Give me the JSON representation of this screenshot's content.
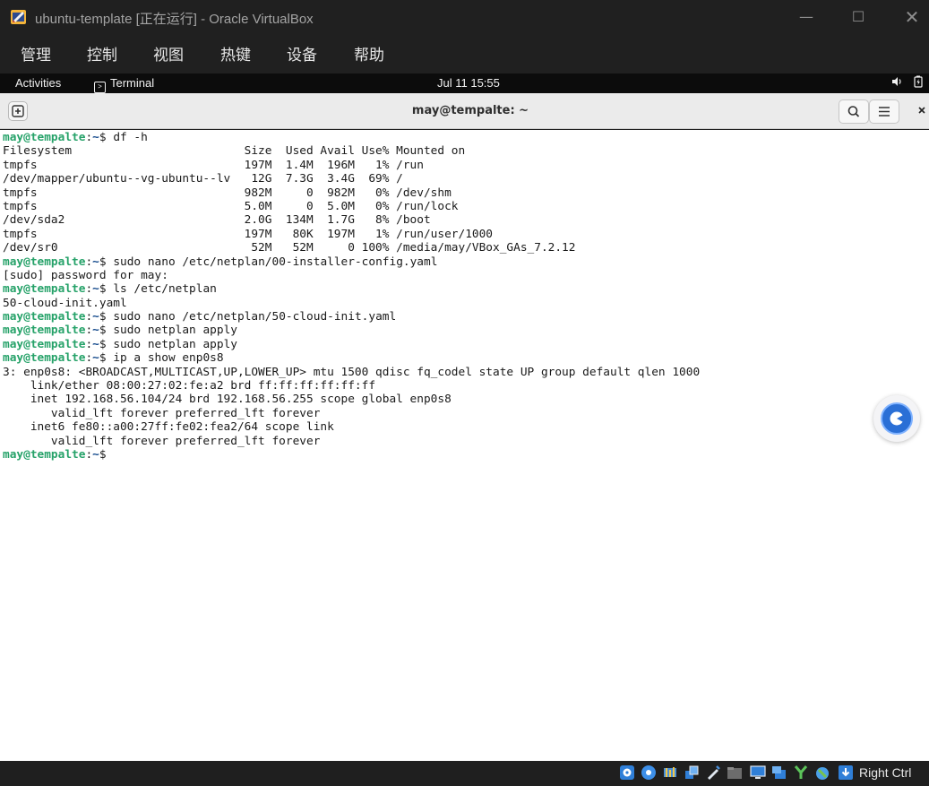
{
  "window": {
    "title": "ubuntu-template [正在运行] - Oracle VirtualBox",
    "minimize_glyph": "—",
    "maximize_glyph": "☐",
    "close_glyph": "✕"
  },
  "menu": [
    "管理",
    "控制",
    "视图",
    "热键",
    "设备",
    "帮助"
  ],
  "gnome": {
    "activities": "Activities",
    "app_label": "Terminal",
    "clock": "Jul 11  15:55"
  },
  "terminal": {
    "title": "may@tempalte: ~",
    "lines": [
      {
        "user": "may@tempalte",
        "path": "~",
        "cmd": " df -h"
      },
      {
        "text": "Filesystem                         Size  Used Avail Use% Mounted on"
      },
      {
        "text": "tmpfs                              197M  1.4M  196M   1% /run"
      },
      {
        "text": "/dev/mapper/ubuntu--vg-ubuntu--lv   12G  7.3G  3.4G  69% /"
      },
      {
        "text": "tmpfs                              982M     0  982M   0% /dev/shm"
      },
      {
        "text": "tmpfs                              5.0M     0  5.0M   0% /run/lock"
      },
      {
        "text": "/dev/sda2                          2.0G  134M  1.7G   8% /boot"
      },
      {
        "text": "tmpfs                              197M   80K  197M   1% /run/user/1000"
      },
      {
        "text": "/dev/sr0                            52M   52M     0 100% /media/may/VBox_GAs_7.2.12"
      },
      {
        "user": "may@tempalte",
        "path": "~",
        "cmd": " sudo nano /etc/netplan/00-installer-config.yaml"
      },
      {
        "text": "[sudo] password for may:"
      },
      {
        "user": "may@tempalte",
        "path": "~",
        "cmd": " ls /etc/netplan"
      },
      {
        "text": "50-cloud-init.yaml"
      },
      {
        "user": "may@tempalte",
        "path": "~",
        "cmd": " sudo nano /etc/netplan/50-cloud-init.yaml"
      },
      {
        "user": "may@tempalte",
        "path": "~",
        "cmd": " sudo netplan apply"
      },
      {
        "user": "may@tempalte",
        "path": "~",
        "cmd": " sudo netplan apply"
      },
      {
        "user": "may@tempalte",
        "path": "~",
        "cmd": " ip a show enp0s8"
      },
      {
        "text": "3: enp0s8: <BROADCAST,MULTICAST,UP,LOWER_UP> mtu 1500 qdisc fq_codel state UP group default qlen 1000"
      },
      {
        "text": "    link/ether 08:00:27:02:fe:a2 brd ff:ff:ff:ff:ff:ff"
      },
      {
        "text": "    inet 192.168.56.104/24 brd 192.168.56.255 scope global enp0s8"
      },
      {
        "text": "       valid_lft forever preferred_lft forever"
      },
      {
        "text": "    inet6 fe80::a00:27ff:fe02:fea2/64 scope link"
      },
      {
        "text": "       valid_lft forever preferred_lft forever"
      },
      {
        "user": "may@tempalte",
        "path": "~",
        "cmd": ""
      }
    ]
  },
  "statusbar": {
    "host_key": "Right Ctrl",
    "icons": [
      "optical-drive-icon",
      "cd-icon",
      "audio-icon",
      "network-icon",
      "usb-icon",
      "shared-folders-icon",
      "display-icon",
      "recording-icon",
      "vm-icon",
      "mouse-integration-icon",
      "keyboard-icon"
    ]
  },
  "colors": {
    "prompt_user": "#26a269",
    "prompt_path": "#12488b",
    "assistant_accent": "#2a6fd6"
  }
}
